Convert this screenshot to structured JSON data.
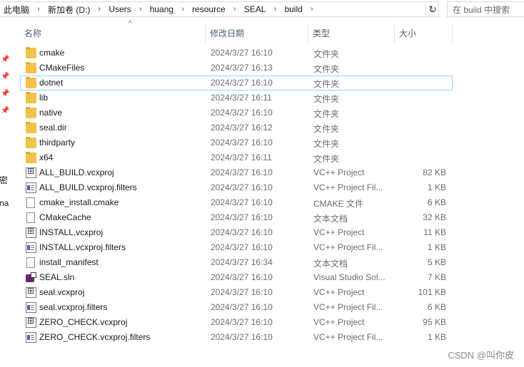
{
  "address_bar": {
    "crumbs": [
      "此电脑",
      "新加卷 (D:)",
      "Users",
      "huang",
      "resource",
      "SEAL",
      "build"
    ],
    "dropdown_icon": "chevron-down-icon",
    "refresh_icon": "refresh-icon"
  },
  "search": {
    "placeholder": "在 build 中搜索"
  },
  "nav": {
    "fragment_1": "密",
    "fragment_2": "na"
  },
  "columns": {
    "name": "名称",
    "date": "修改日期",
    "type": "类型",
    "size": "大小"
  },
  "files": [
    {
      "name": "cmake",
      "date": "2024/3/27 16:10",
      "type": "文件夹",
      "size": "",
      "icon": "folder-icon",
      "selected": false
    },
    {
      "name": "CMakeFiles",
      "date": "2024/3/27 16:13",
      "type": "文件夹",
      "size": "",
      "icon": "folder-icon",
      "selected": false
    },
    {
      "name": "dotnet",
      "date": "2024/3/27 16:10",
      "type": "文件夹",
      "size": "",
      "icon": "folder-icon",
      "selected": true
    },
    {
      "name": "lib",
      "date": "2024/3/27 16:11",
      "type": "文件夹",
      "size": "",
      "icon": "folder-icon",
      "selected": false
    },
    {
      "name": "native",
      "date": "2024/3/27 16:10",
      "type": "文件夹",
      "size": "",
      "icon": "folder-icon",
      "selected": false
    },
    {
      "name": "seal.dir",
      "date": "2024/3/27 16:12",
      "type": "文件夹",
      "size": "",
      "icon": "folder-icon",
      "selected": false
    },
    {
      "name": "thirdparty",
      "date": "2024/3/27 16:10",
      "type": "文件夹",
      "size": "",
      "icon": "folder-icon",
      "selected": false
    },
    {
      "name": "x64",
      "date": "2024/3/27 16:11",
      "type": "文件夹",
      "size": "",
      "icon": "folder-icon",
      "selected": false
    },
    {
      "name": "ALL_BUILD.vcxproj",
      "date": "2024/3/27 16:10",
      "type": "VC++ Project",
      "size": "82 KB",
      "icon": "vcxproj-icon",
      "selected": false
    },
    {
      "name": "ALL_BUILD.vcxproj.filters",
      "date": "2024/3/27 16:10",
      "type": "VC++ Project Fil...",
      "size": "1 KB",
      "icon": "filters-icon",
      "selected": false
    },
    {
      "name": "cmake_install.cmake",
      "date": "2024/3/27 16:10",
      "type": "CMAKE 文件",
      "size": "6 KB",
      "icon": "file-icon",
      "selected": false
    },
    {
      "name": "CMakeCache",
      "date": "2024/3/27 16:10",
      "type": "文本文档",
      "size": "32 KB",
      "icon": "file-icon",
      "selected": false
    },
    {
      "name": "INSTALL.vcxproj",
      "date": "2024/3/27 16:10",
      "type": "VC++ Project",
      "size": "11 KB",
      "icon": "vcxproj-icon",
      "selected": false
    },
    {
      "name": "INSTALL.vcxproj.filters",
      "date": "2024/3/27 16:10",
      "type": "VC++ Project Fil...",
      "size": "1 KB",
      "icon": "filters-icon",
      "selected": false
    },
    {
      "name": "install_manifest",
      "date": "2024/3/27 16:34",
      "type": "文本文档",
      "size": "5 KB",
      "icon": "file-icon",
      "selected": false
    },
    {
      "name": "SEAL.sln",
      "date": "2024/3/27 16:10",
      "type": "Visual Studio Sol...",
      "size": "7 KB",
      "icon": "sln-icon",
      "selected": false
    },
    {
      "name": "seal.vcxproj",
      "date": "2024/3/27 16:10",
      "type": "VC++ Project",
      "size": "101 KB",
      "icon": "vcxproj-icon",
      "selected": false
    },
    {
      "name": "seal.vcxproj.filters",
      "date": "2024/3/27 16:10",
      "type": "VC++ Project Fil...",
      "size": "6 KB",
      "icon": "filters-icon",
      "selected": false
    },
    {
      "name": "ZERO_CHECK.vcxproj",
      "date": "2024/3/27 16:10",
      "type": "VC++ Project",
      "size": "95 KB",
      "icon": "vcxproj-icon",
      "selected": false
    },
    {
      "name": "ZERO_CHECK.vcxproj.filters",
      "date": "2024/3/27 16:10",
      "type": "VC++ Project Fil...",
      "size": "1 KB",
      "icon": "filters-icon",
      "selected": false
    }
  ],
  "watermark": "CSDN @叫你皮"
}
